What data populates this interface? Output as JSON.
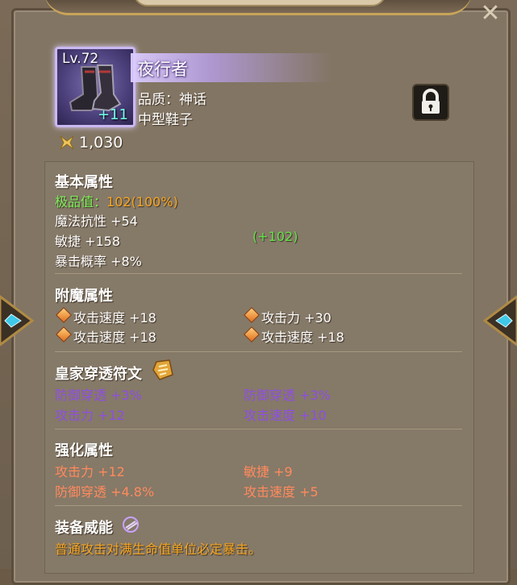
{
  "item": {
    "level": "Lv.72",
    "enhance": "+11",
    "name": "夜行者",
    "quality": "品质：神话",
    "type": "中型鞋子",
    "gold": "1,030"
  },
  "icons": {
    "close": "close-icon",
    "lock": "lock-icon",
    "gold": "gold-icon",
    "enchant_bullet": "diamond-bullet-icon",
    "rune": "rune-icon",
    "power": "power-icon"
  },
  "basic": {
    "title": "基本属性",
    "perfect_label": "极品值：",
    "perfect_value": "102(100%)",
    "stats": [
      "魔法抗性 +54",
      "敏捷 +158",
      "暴击概率 +8%"
    ],
    "bonus": "(+102)"
  },
  "enchant": {
    "title": "附魔属性",
    "stats": [
      "攻击速度 +18",
      "攻击力 +30",
      "攻击速度 +18",
      "攻击速度 +18"
    ]
  },
  "rune": {
    "title": "皇家穿透符文",
    "stats": [
      "防御穿透 +3%",
      "防御穿透 +3%",
      "攻击力 +12",
      "攻击速度 +10"
    ]
  },
  "upgrade": {
    "title": "强化属性",
    "stats": [
      "攻击力 +12",
      "敏捷 +9",
      "防御穿透 +4.8%",
      "攻击速度 +5"
    ]
  },
  "power": {
    "title": "装备威能",
    "description": "普通攻击对满生命值单位必定暴击。"
  },
  "colors": {
    "perfect_label": "#7cf05a",
    "perfect_value": "#f5a623",
    "rune_stat": "#8e4fe0",
    "upgrade_stat": "#ff8a5c",
    "power_desc": "#f5a623",
    "bonus": "#62e24a"
  }
}
